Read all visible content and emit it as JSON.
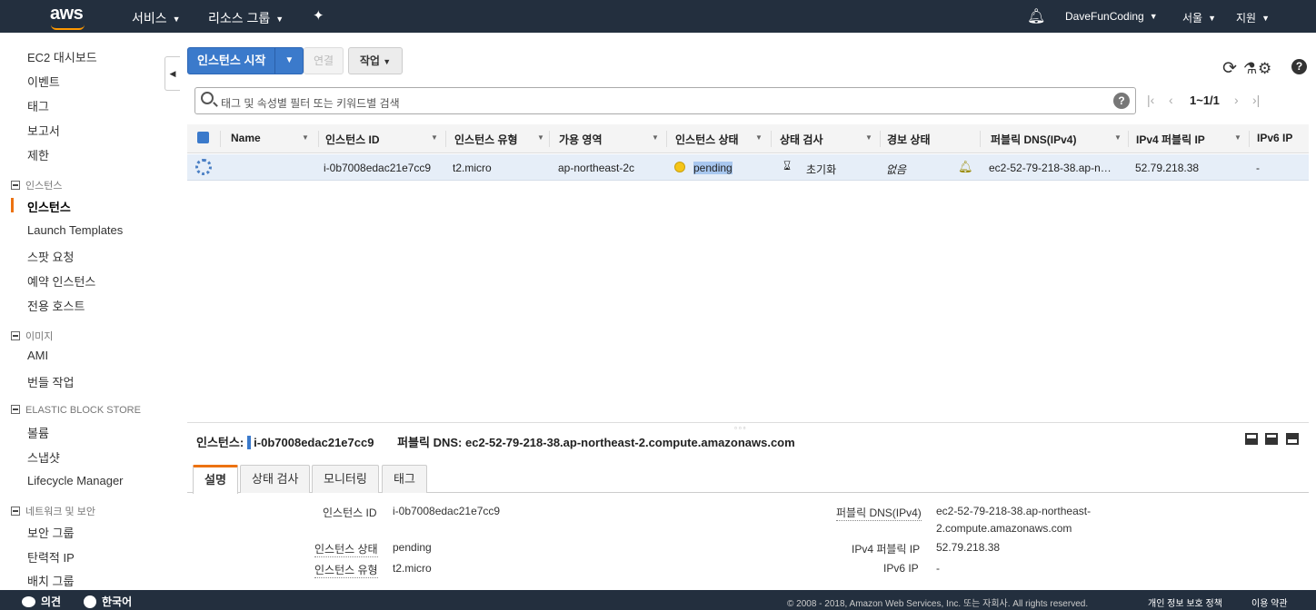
{
  "topnav": {
    "logo": "aws",
    "services": "서비스",
    "resource_groups": "리소스 그룹",
    "user": "DaveFunCoding",
    "region": "서울",
    "support": "지원"
  },
  "sidebar": {
    "items": [
      {
        "label": "EC2 대시보드"
      },
      {
        "label": "이벤트"
      },
      {
        "label": "태그"
      },
      {
        "label": "보고서"
      },
      {
        "label": "제한"
      }
    ],
    "section_instances": "인스턴스",
    "instances_items": [
      {
        "label": "인스턴스"
      },
      {
        "label": "Launch Templates"
      },
      {
        "label": "스팟 요청"
      },
      {
        "label": "예약 인스턴스"
      },
      {
        "label": "전용 호스트"
      }
    ],
    "section_images": "이미지",
    "images_items": [
      {
        "label": "AMI"
      },
      {
        "label": "번들 작업"
      }
    ],
    "section_ebs": "ELASTIC BLOCK STORE",
    "ebs_items": [
      {
        "label": "볼륨"
      },
      {
        "label": "스냅샷"
      },
      {
        "label": "Lifecycle Manager"
      }
    ],
    "section_network": "네트워크 및 보안",
    "network_items": [
      {
        "label": "보안 그룹"
      },
      {
        "label": "탄력적 IP"
      },
      {
        "label": "배치 그룹"
      }
    ]
  },
  "toolbar": {
    "launch": "인스턴스 시작",
    "connect": "연결",
    "actions": "작업"
  },
  "search": {
    "placeholder": "태그 및 속성별 필터 또는 키워드별 검색"
  },
  "pager": {
    "count": "1~1/1"
  },
  "table": {
    "columns": [
      "Name",
      "인스턴스 ID",
      "인스턴스 유형",
      "가용 영역",
      "인스턴스 상태",
      "상태 검사",
      "경보 상태",
      "퍼블릭 DNS(IPv4)",
      "IPv4 퍼블릭 IP",
      "IPv6 IP"
    ],
    "row": {
      "name": "",
      "instance_id": "i-0b7008edac21e7cc9",
      "type": "t2.micro",
      "az": "ap-northeast-2c",
      "state": "pending",
      "status_check": "초기화",
      "alarm": "없음",
      "public_dns": "ec2-52-79-218-38.ap-n…",
      "ipv4": "52.79.218.38",
      "ipv6": "-"
    }
  },
  "details": {
    "instance_label": "인스턴스:",
    "instance_id": "i-0b7008edac21e7cc9",
    "dns_label": "퍼블릭 DNS:",
    "dns_value": "ec2-52-79-218-38.ap-northeast-2.compute.amazonaws.com",
    "tabs": [
      "설명",
      "상태 검사",
      "모니터링",
      "태그"
    ],
    "fields": {
      "id_label": "인스턴스 ID",
      "id_value": "i-0b7008edac21e7cc9",
      "state_label": "인스턴스 상태",
      "state_value": "pending",
      "type_label": "인스턴스 유형",
      "type_value": "t2.micro",
      "dns_label": "퍼블릭 DNS(IPv4)",
      "dns_value_1": "ec2-52-79-218-38.ap-northeast-",
      "dns_value_2": "2.compute.amazonaws.com",
      "ipv4_label": "IPv4 퍼블릭 IP",
      "ipv4_value": "52.79.218.38",
      "ipv6_label": "IPv6 IP",
      "ipv6_value": "-"
    }
  },
  "footer": {
    "feedback": "의견",
    "language": "한국어",
    "copyright": "© 2008 - 2018, Amazon Web Services, Inc. 또는 자회사. All rights reserved.",
    "privacy": "개인 정보 보호 정책",
    "terms": "이용 약관"
  },
  "colors": {
    "nav_bg": "#232f3e",
    "primary": "#3b7acb",
    "accent": "#ec7211",
    "selected_row": "#e6eef8"
  }
}
